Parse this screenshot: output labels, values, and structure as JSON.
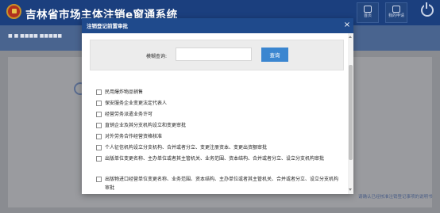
{
  "app": {
    "title": "吉林省市场主体注销e窗通系统",
    "header_buttons": [
      {
        "label": "首页",
        "icon": "home-icon"
      },
      {
        "label": "我的申请",
        "icon": "document-icon"
      }
    ],
    "power_icon": "power-icon",
    "sub_text": "■ ■ ■■■■ ■■■■■",
    "background_right_text": "请确认已经核准注销登记事项的说明书"
  },
  "modal": {
    "title": "注销登记前置审批",
    "close": "×",
    "search": {
      "label": "模糊查询:",
      "value": "",
      "placeholder": "",
      "button": "查询"
    },
    "items": [
      {
        "label": "民用爆炸物品销售",
        "checked": false
      },
      {
        "label": "保安服务企业变更法定代表人",
        "checked": false
      },
      {
        "label": "经营劳务派遣业务许可",
        "checked": false
      },
      {
        "label": "直销企业及其分支机构设立和变更审批",
        "checked": false
      },
      {
        "label": "对外劳务合作经营资格核准",
        "checked": false
      },
      {
        "label": "个人征信机构设立分支机构、合并或者分立、变更注册资本、变更出资额审批",
        "checked": false
      },
      {
        "label": "出版单位变更名称、主办单位或者其主管机关、业务范围、资本结构、合并或者分立、设立分支机构审批",
        "checked": false
      },
      {
        "label": "出版物进口经营单位变更名称、业务范围、资本结构、主办单位或者其主管机关、合并或者分立、设立分支机构审批",
        "checked": false
      }
    ]
  },
  "colors": {
    "header": "#1b3f7e",
    "modal_header": "#1f4a8c",
    "button": "#3b86d0",
    "overlay": "#8f9196"
  }
}
